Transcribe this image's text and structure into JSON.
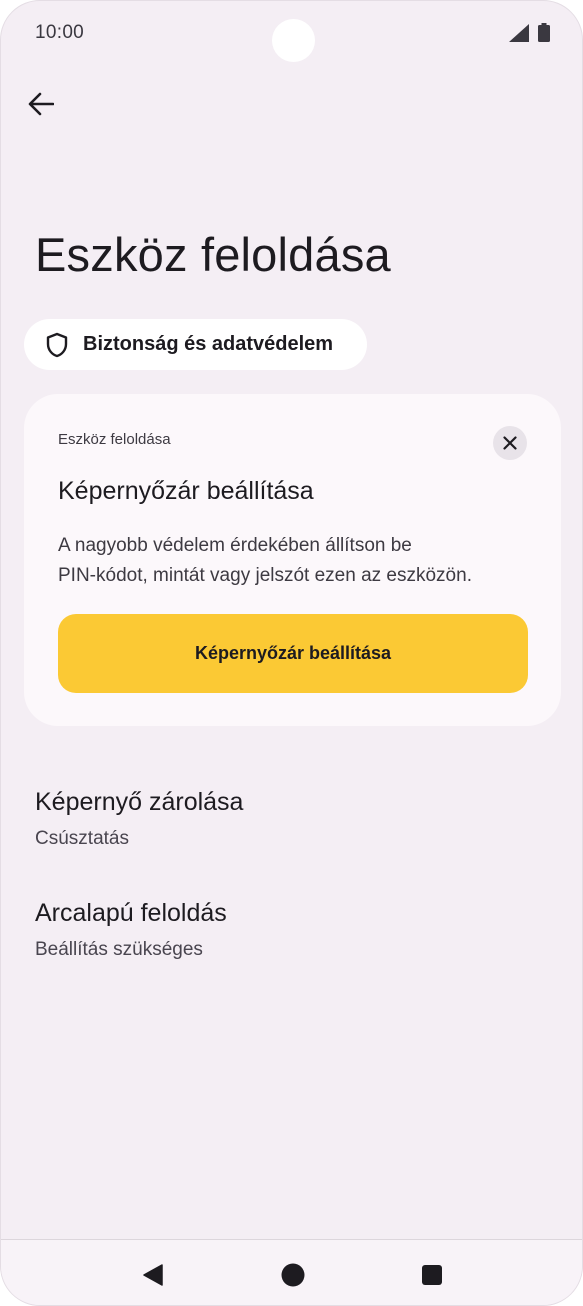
{
  "status_bar": {
    "time": "10:00",
    "icons": [
      "signal-icon",
      "battery-icon"
    ]
  },
  "header": {
    "back_icon": "arrow-left-icon",
    "title": "Eszköz feloldása"
  },
  "chip": {
    "icon": "shield-icon",
    "label": "Biztonság és adatvédelem"
  },
  "card": {
    "overline": "Eszköz feloldása",
    "close_icon": "close-icon",
    "title": "Képernyőzár beállítása",
    "body_line1": "A nagyobb védelem érdekében állítson be",
    "body_line2": "PIN-kódot, mintát vagy jelszót ezen az eszközön.",
    "action_label": "Képernyőzár beállítása"
  },
  "settings": [
    {
      "title": "Képernyő zárolása",
      "summary": "Csúsztatás"
    },
    {
      "title": "Arcalapú feloldás",
      "summary": "Beállítás szükséges"
    }
  ],
  "nav_bar": {
    "icons": [
      "back-triangle-icon",
      "home-circle-icon",
      "recents-square-icon"
    ]
  },
  "colors": {
    "background": "#f4eef4",
    "card": "#fcf8fb",
    "accent": "#fbc934",
    "text": "#1d1b20"
  }
}
